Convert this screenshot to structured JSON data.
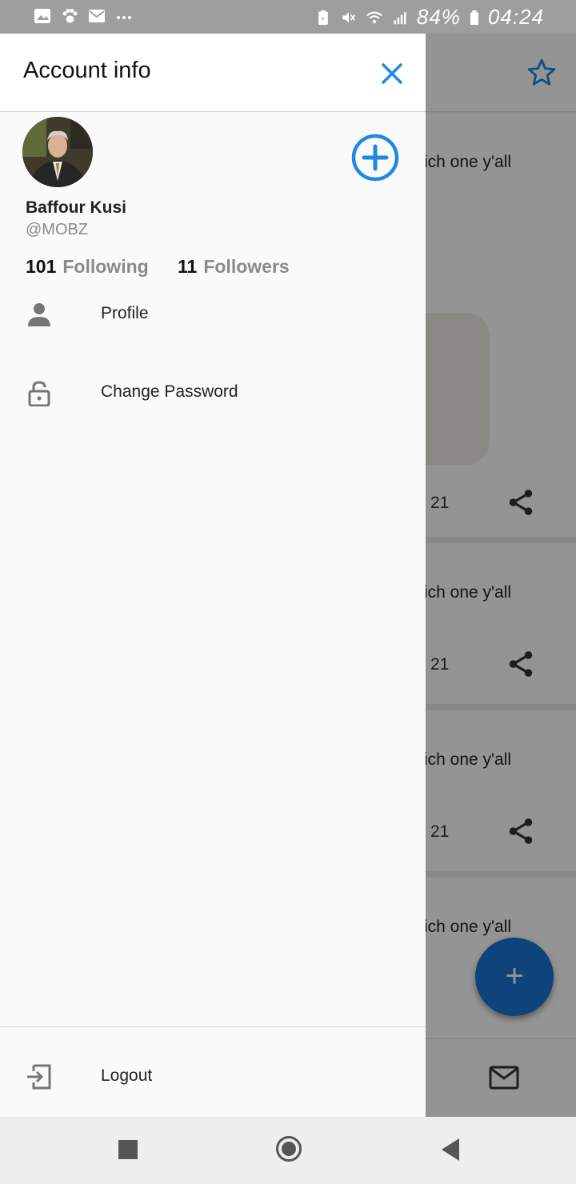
{
  "status_bar": {
    "left_icons": [
      "image-icon",
      "paw-icon",
      "mail-icon",
      "more-dots-icon"
    ],
    "right_icons": [
      "battery-saver-icon",
      "mute-icon",
      "wifi-icon",
      "signal-icon"
    ],
    "battery": "84%",
    "time": "04:24"
  },
  "drawer": {
    "title": "Account info",
    "user": {
      "name": "Baffour Kusi",
      "handle": "@MOBZ"
    },
    "stats": {
      "following_count": "101",
      "following_label": "Following",
      "followers_count": "11",
      "followers_label": "Followers"
    },
    "menu": [
      {
        "label": "Profile",
        "icon": "person-icon"
      },
      {
        "label": "Change Password",
        "icon": "lock-icon"
      }
    ],
    "logout": {
      "label": "Logout",
      "icon": "logout-icon"
    }
  },
  "background": {
    "posts": [
      {
        "text": "ich one y'all",
        "count": "21"
      },
      {
        "text": "ich one y'all",
        "count": "21"
      },
      {
        "text": "ich one y'all",
        "count": "21"
      },
      {
        "text": "ich one y'all",
        "count": ""
      }
    ],
    "fab_label": "+"
  },
  "colors": {
    "accent": "#1e88e5",
    "fab": "#1976d2"
  }
}
